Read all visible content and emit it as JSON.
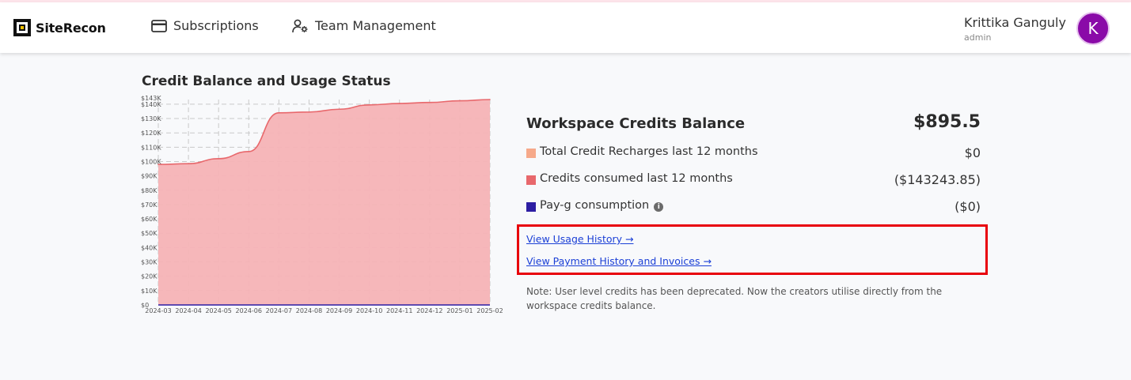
{
  "app": {
    "brand": "SiteRecon"
  },
  "nav": {
    "subscriptions": "Subscriptions",
    "team_management": "Team Management"
  },
  "user": {
    "name": "Krittika Ganguly",
    "role": "admin",
    "initial": "K"
  },
  "chart_title": "Credit Balance and Usage Status",
  "chart_data": {
    "type": "area",
    "title": "Credit Balance and Usage Status",
    "xlabel": "",
    "ylabel": "",
    "x": [
      "2024-03",
      "2024-04",
      "2024-05",
      "2024-06",
      "2024-07",
      "2024-08",
      "2024-09",
      "2024-10",
      "2024-11",
      "2024-12",
      "2025-01",
      "2025-02"
    ],
    "y_ticks": [
      "$0",
      "$10K",
      "$20K",
      "$30K",
      "$40K",
      "$50K",
      "$60K",
      "$70K",
      "$80K",
      "$90K",
      "$100K",
      "$110K",
      "$120K",
      "$130K",
      "$140K",
      "$143K"
    ],
    "ylim": [
      0,
      143243.85
    ],
    "grid": true,
    "series": [
      {
        "values": [
          98000,
          98500,
          102000,
          107000,
          134000,
          134500,
          136500,
          139500,
          140500,
          141200,
          142400,
          143243.85
        ],
        "color": "#e8686c",
        "fill": "#f6b3b6"
      }
    ]
  },
  "workspace": {
    "balance_label": "Workspace Credits Balance",
    "balance_value": "$895.5",
    "stats": [
      {
        "label": "Total Credit Recharges last 12 months",
        "value": "$0",
        "color": "#f6a98a"
      },
      {
        "label": "Credits consumed last 12 months",
        "value": "($143243.85)",
        "color": "#e8686c"
      },
      {
        "label": "Pay-g consumption",
        "value": "($0)",
        "color": "#2d1ea3",
        "info_icon": "info-icon"
      }
    ],
    "info_glyph": "i"
  },
  "links": {
    "usage_history": "View Usage History",
    "payment_history": "View Payment History and Invoices"
  },
  "note": "Note: User level credits has been deprecated. Now the creators utilise directly from the workspace credits balance."
}
